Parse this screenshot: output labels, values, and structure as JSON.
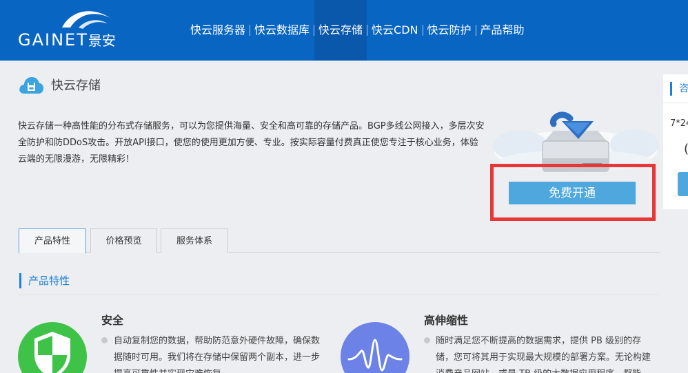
{
  "header": {
    "logo_text": "GAINET",
    "logo_cn": "景安",
    "nav": [
      {
        "label": "快云服务器"
      },
      {
        "label": "快云数据库"
      },
      {
        "label": "快云存储"
      },
      {
        "label": "快云CDN"
      },
      {
        "label": "快云防护"
      },
      {
        "label": "产品帮助"
      }
    ],
    "active_index": 2
  },
  "page": {
    "title": "快云存储",
    "description": "快云存储一种高性能的分布式存储服务，可以为您提供海量、安全和高可靠的存储产品。BGP多线公网接入，多层次安全防护和防DDoS攻击。开放API接口，使您的使用更加方便、专业。按实际容量付费真正使您专注于核心业务，体验云端的无限漫游，无限精彩！",
    "cta_label": "免费开通"
  },
  "tabs": [
    {
      "label": "产品特性"
    },
    {
      "label": "价格预览"
    },
    {
      "label": "服务体系"
    }
  ],
  "section": {
    "title": "产品特性"
  },
  "features": [
    {
      "title": "安全",
      "text": "自动复制您的数据，帮助防范意外硬件故障，确保数据随时可用。我们将在存储中保留两个副本，进一步提高可靠性并实现灾难恢复。"
    },
    {
      "title": "高伸缩性",
      "text": "随时满足您不断提高的数据需求，提供 PB 级别的存储，您可将其用于实现最大规模的部署方案。无论构建消费产品网站，或是 TB 级的大数据应用程序，都能"
    }
  ],
  "side_widget": {
    "title": "咨",
    "hours": "7*24",
    "paren": "("
  },
  "colors": {
    "header_bg": "#0865c2",
    "accent": "#1f7fd6",
    "cta_bg": "#4ea7dd",
    "highlight_border": "#e83737",
    "shield_green": "#3ec348",
    "wave_purple": "#6c82e6"
  },
  "icons": {
    "title_icon": "cloud-storage-icon",
    "feature_1": "shield-icon",
    "feature_2": "wave-icon",
    "hero": "hard-drive-download-icon"
  }
}
